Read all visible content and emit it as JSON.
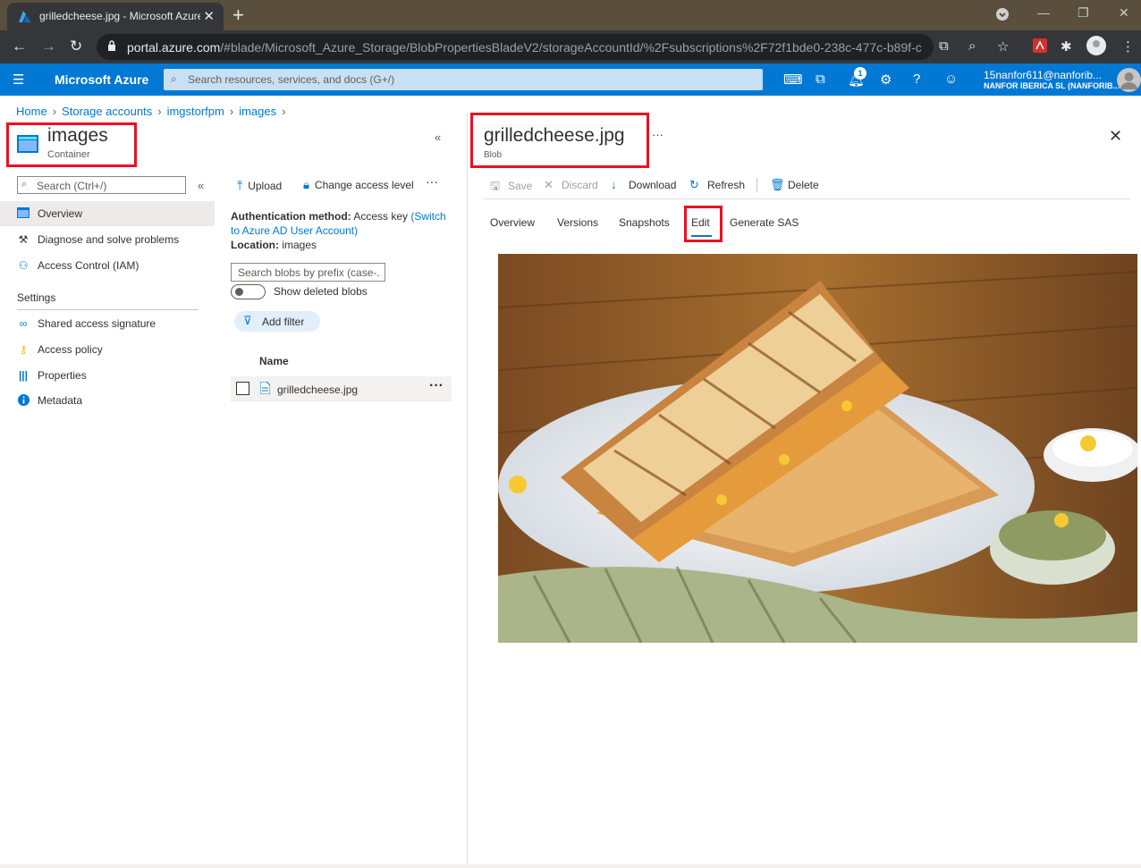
{
  "browser": {
    "tab_title": "grilledcheese.jpg - Microsoft Azure",
    "url_host": "portal.azure.com",
    "url_path": "/#blade/Microsoft_Azure_Storage/BlobPropertiesBladeV2/storageAccountId/%2Fsubscriptions%2F72f1bde0-238c-477c-b89f-c..."
  },
  "azure": {
    "brand": "Microsoft Azure",
    "search_placeholder": "Search resources, services, and docs (G+/)",
    "notification_count": "1",
    "account_user": "15nanfor611@nanforib...",
    "account_org": "NANFOR IBERICA SL (NANFORIB..."
  },
  "breadcrumb": [
    "Home",
    "Storage accounts",
    "imgstorfpm",
    "images"
  ],
  "container_blade": {
    "title": "images",
    "subtitle": "Container",
    "search_placeholder": "Search (Ctrl+/)",
    "menu": [
      {
        "label": "Overview",
        "icon": "overview-icon",
        "selected": true
      },
      {
        "label": "Diagnose and solve problems",
        "icon": "wrench-icon"
      },
      {
        "label": "Access Control (IAM)",
        "icon": "people-icon"
      }
    ],
    "settings_heading": "Settings",
    "settings_menu": [
      {
        "label": "Shared access signature",
        "icon": "link-icon"
      },
      {
        "label": "Access policy",
        "icon": "key-icon"
      },
      {
        "label": "Properties",
        "icon": "properties-icon"
      },
      {
        "label": "Metadata",
        "icon": "info-icon"
      }
    ]
  },
  "container_content": {
    "toolbar": {
      "upload": "Upload",
      "change_access": "Change access level"
    },
    "auth_label": "Authentication method:",
    "auth_value": "Access key",
    "auth_switch": "(Switch to Azure AD User Account)",
    "location_label": "Location:",
    "location_value": "images",
    "prefix_placeholder": "Search blobs by prefix (case-...",
    "show_deleted": "Show deleted blobs",
    "add_filter": "Add filter",
    "column_name": "Name",
    "blobs": [
      {
        "name": "grilledcheese.jpg"
      }
    ]
  },
  "blob_blade": {
    "title": "grilledcheese.jpg",
    "subtitle": "Blob",
    "toolbar": {
      "save": "Save",
      "discard": "Discard",
      "download": "Download",
      "refresh": "Refresh",
      "delete": "Delete"
    },
    "tabs": [
      "Overview",
      "Versions",
      "Snapshots",
      "Edit",
      "Generate SAS"
    ],
    "active_tab": "Edit"
  },
  "colors": {
    "azure_blue": "#0078d4",
    "highlight_red": "#e81123"
  }
}
